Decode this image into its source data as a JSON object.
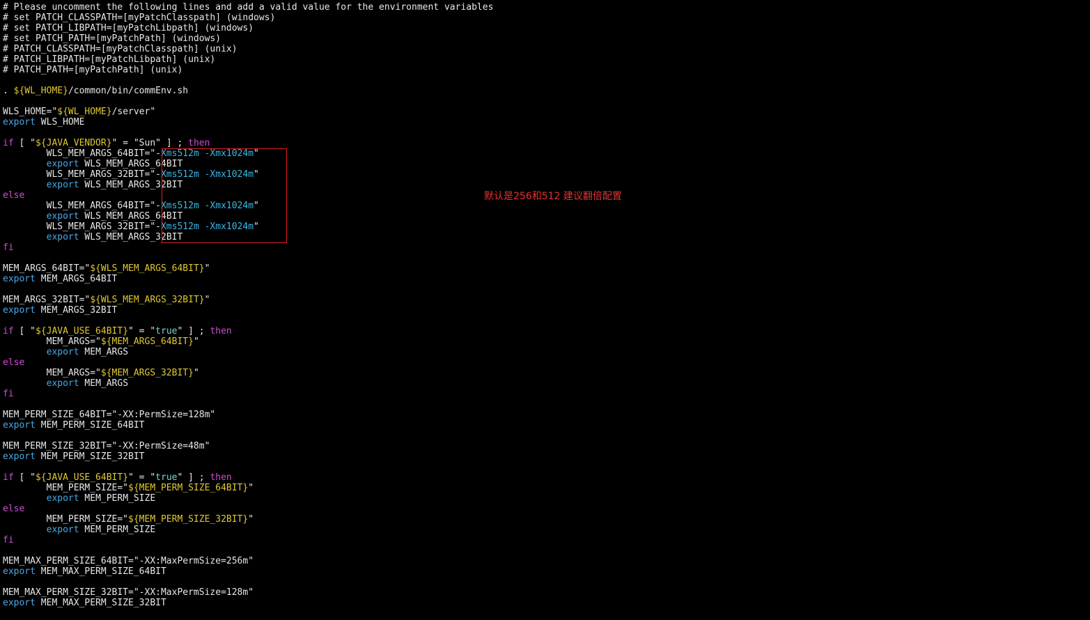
{
  "editor": {
    "background": "#000000",
    "colors": {
      "text": "#e8e8e8",
      "keyword": "#d24bd6",
      "export": "#4aa8e8",
      "variable": "#e0c832",
      "value": "#3ab8e8",
      "annotation": "#e83030",
      "box": "#e02020"
    },
    "lines": [
      [
        {
          "t": "comment",
          "v": "# Please uncomment the following lines and add a valid value for the environment variables"
        }
      ],
      [
        {
          "t": "comment",
          "v": "# set PATCH_CLASSPATH=[myPatchClasspath] (windows)"
        }
      ],
      [
        {
          "t": "comment",
          "v": "# set PATCH_LIBPATH=[myPatchLibpath] (windows)"
        }
      ],
      [
        {
          "t": "comment",
          "v": "# set PATCH_PATH=[myPatchPath] (windows)"
        }
      ],
      [
        {
          "t": "comment",
          "v": "# PATCH_CLASSPATH=[myPatchClasspath] (unix)"
        }
      ],
      [
        {
          "t": "comment",
          "v": "# PATCH_LIBPATH=[myPatchLibpath] (unix)"
        }
      ],
      [
        {
          "t": "comment",
          "v": "# PATCH_PATH=[myPatchPath] (unix)"
        }
      ],
      [],
      [
        {
          "t": "text",
          "v": ". "
        },
        {
          "t": "var",
          "v": "${WL_HOME}"
        },
        {
          "t": "text",
          "v": "/common/bin/commEnv.sh"
        }
      ],
      [],
      [
        {
          "t": "text",
          "v": "WLS_HOME=\""
        },
        {
          "t": "var",
          "v": "${WL_HOME}"
        },
        {
          "t": "text",
          "v": "/server\""
        }
      ],
      [
        {
          "t": "export",
          "v": "export"
        },
        {
          "t": "text",
          "v": " WLS_HOME"
        }
      ],
      [],
      [
        {
          "t": "kw",
          "v": "if"
        },
        {
          "t": "text",
          "v": " [ \""
        },
        {
          "t": "var",
          "v": "${JAVA_VENDOR}"
        },
        {
          "t": "text",
          "v": "\" = \"Sun\" ] ; "
        },
        {
          "t": "kw",
          "v": "then"
        }
      ],
      [
        {
          "t": "text",
          "v": "        WLS_MEM_ARGS_64BIT=\"-"
        },
        {
          "t": "val",
          "v": "Xms512m -Xmx1024m"
        },
        {
          "t": "text",
          "v": "\""
        }
      ],
      [
        {
          "t": "text",
          "v": "        "
        },
        {
          "t": "export",
          "v": "export"
        },
        {
          "t": "text",
          "v": " WLS_MEM_ARGS_64BIT"
        }
      ],
      [
        {
          "t": "text",
          "v": "        WLS_MEM_ARGS_32BIT=\"-"
        },
        {
          "t": "val",
          "v": "Xms512m -Xmx1024m"
        },
        {
          "t": "text",
          "v": "\""
        }
      ],
      [
        {
          "t": "text",
          "v": "        "
        },
        {
          "t": "export",
          "v": "export"
        },
        {
          "t": "text",
          "v": " WLS_MEM_ARGS_32BIT"
        }
      ],
      [
        {
          "t": "kw",
          "v": "else"
        }
      ],
      [
        {
          "t": "text",
          "v": "        WLS_MEM_ARGS_64BIT=\"-"
        },
        {
          "t": "val",
          "v": "Xms512m -Xmx1024m"
        },
        {
          "t": "text",
          "v": "\""
        }
      ],
      [
        {
          "t": "text",
          "v": "        "
        },
        {
          "t": "export",
          "v": "export"
        },
        {
          "t": "text",
          "v": " WLS_MEM_ARGS_64BIT"
        }
      ],
      [
        {
          "t": "text",
          "v": "        WLS_MEM_ARGS_32BIT=\"-"
        },
        {
          "t": "val",
          "v": "Xms512m -Xmx1024m"
        },
        {
          "t": "text",
          "v": "\""
        }
      ],
      [
        {
          "t": "text",
          "v": "        "
        },
        {
          "t": "export",
          "v": "export"
        },
        {
          "t": "text",
          "v": " WLS_MEM_ARGS_32BIT"
        }
      ],
      [
        {
          "t": "kw",
          "v": "fi"
        }
      ],
      [],
      [
        {
          "t": "text",
          "v": "MEM_ARGS_64BIT=\""
        },
        {
          "t": "var",
          "v": "${WLS_MEM_ARGS_64BIT}"
        },
        {
          "t": "text",
          "v": "\""
        }
      ],
      [
        {
          "t": "export",
          "v": "export"
        },
        {
          "t": "text",
          "v": " MEM_ARGS_64BIT"
        }
      ],
      [],
      [
        {
          "t": "text",
          "v": "MEM_ARGS_32BIT=\""
        },
        {
          "t": "var",
          "v": "${WLS_MEM_ARGS_32BIT}"
        },
        {
          "t": "text",
          "v": "\""
        }
      ],
      [
        {
          "t": "export",
          "v": "export"
        },
        {
          "t": "text",
          "v": " MEM_ARGS_32BIT"
        }
      ],
      [],
      [
        {
          "t": "kw",
          "v": "if"
        },
        {
          "t": "text",
          "v": " [ \""
        },
        {
          "t": "var",
          "v": "${JAVA_USE_64BIT}"
        },
        {
          "t": "text",
          "v": "\" = \""
        },
        {
          "t": "lit",
          "v": "true"
        },
        {
          "t": "text",
          "v": "\" ] ; "
        },
        {
          "t": "kw",
          "v": "then"
        }
      ],
      [
        {
          "t": "text",
          "v": "        MEM_ARGS=\""
        },
        {
          "t": "var",
          "v": "${MEM_ARGS_64BIT}"
        },
        {
          "t": "text",
          "v": "\""
        }
      ],
      [
        {
          "t": "text",
          "v": "        "
        },
        {
          "t": "export",
          "v": "export"
        },
        {
          "t": "text",
          "v": " MEM_ARGS"
        }
      ],
      [
        {
          "t": "kw",
          "v": "else"
        }
      ],
      [
        {
          "t": "text",
          "v": "        MEM_ARGS=\""
        },
        {
          "t": "var",
          "v": "${MEM_ARGS_32BIT}"
        },
        {
          "t": "text",
          "v": "\""
        }
      ],
      [
        {
          "t": "text",
          "v": "        "
        },
        {
          "t": "export",
          "v": "export"
        },
        {
          "t": "text",
          "v": " MEM_ARGS"
        }
      ],
      [
        {
          "t": "kw",
          "v": "fi"
        }
      ],
      [],
      [
        {
          "t": "text",
          "v": "MEM_PERM_SIZE_64BIT=\"-XX:PermSize=128m\""
        }
      ],
      [
        {
          "t": "export",
          "v": "export"
        },
        {
          "t": "text",
          "v": " MEM_PERM_SIZE_64BIT"
        }
      ],
      [],
      [
        {
          "t": "text",
          "v": "MEM_PERM_SIZE_32BIT=\"-XX:PermSize=48m\""
        }
      ],
      [
        {
          "t": "export",
          "v": "export"
        },
        {
          "t": "text",
          "v": " MEM_PERM_SIZE_32BIT"
        }
      ],
      [],
      [
        {
          "t": "kw",
          "v": "if"
        },
        {
          "t": "text",
          "v": " [ \""
        },
        {
          "t": "var",
          "v": "${JAVA_USE_64BIT}"
        },
        {
          "t": "text",
          "v": "\" = \""
        },
        {
          "t": "lit",
          "v": "true"
        },
        {
          "t": "text",
          "v": "\" ] ; "
        },
        {
          "t": "kw",
          "v": "then"
        }
      ],
      [
        {
          "t": "text",
          "v": "        MEM_PERM_SIZE=\""
        },
        {
          "t": "var",
          "v": "${MEM_PERM_SIZE_64BIT}"
        },
        {
          "t": "text",
          "v": "\""
        }
      ],
      [
        {
          "t": "text",
          "v": "        "
        },
        {
          "t": "export",
          "v": "export"
        },
        {
          "t": "text",
          "v": " MEM_PERM_SIZE"
        }
      ],
      [
        {
          "t": "kw",
          "v": "else"
        }
      ],
      [
        {
          "t": "text",
          "v": "        MEM_PERM_SIZE=\""
        },
        {
          "t": "var",
          "v": "${MEM_PERM_SIZE_32BIT}"
        },
        {
          "t": "text",
          "v": "\""
        }
      ],
      [
        {
          "t": "text",
          "v": "        "
        },
        {
          "t": "export",
          "v": "export"
        },
        {
          "t": "text",
          "v": " MEM_PERM_SIZE"
        }
      ],
      [
        {
          "t": "kw",
          "v": "fi"
        }
      ],
      [],
      [
        {
          "t": "text",
          "v": "MEM_MAX_PERM_SIZE_64BIT=\"-XX:MaxPermSize=256m\""
        }
      ],
      [
        {
          "t": "export",
          "v": "export"
        },
        {
          "t": "text",
          "v": " MEM_MAX_PERM_SIZE_64BIT"
        }
      ],
      [],
      [
        {
          "t": "text",
          "v": "MEM_MAX_PERM_SIZE_32BIT=\"-XX:MaxPermSize=128m\""
        }
      ],
      [
        {
          "t": "export",
          "v": "export"
        },
        {
          "t": "text",
          "v": " MEM_MAX_PERM_SIZE_32BIT"
        }
      ]
    ]
  },
  "annotation": {
    "text": "默认是256和512 建议翻倍配置"
  }
}
